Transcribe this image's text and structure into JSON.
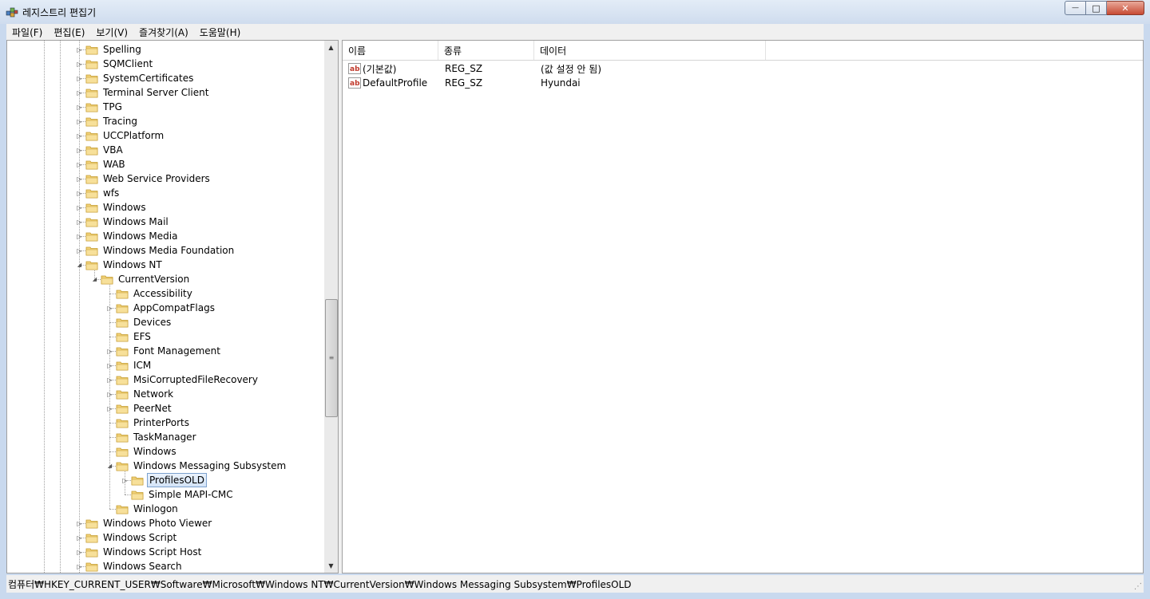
{
  "window": {
    "title": "레지스트리 편집기",
    "minimize_glyph": "—",
    "maximize_glyph": "□",
    "close_glyph": "✕"
  },
  "menu": [
    "파일(F)",
    "편집(E)",
    "보기(V)",
    "즐겨찾기(A)",
    "도움말(H)"
  ],
  "tree": [
    {
      "label": "Spelling",
      "depth": 0,
      "expander": "collapsed"
    },
    {
      "label": "SQMClient",
      "depth": 0,
      "expander": "collapsed"
    },
    {
      "label": "SystemCertificates",
      "depth": 0,
      "expander": "collapsed"
    },
    {
      "label": "Terminal Server Client",
      "depth": 0,
      "expander": "collapsed"
    },
    {
      "label": "TPG",
      "depth": 0,
      "expander": "collapsed"
    },
    {
      "label": "Tracing",
      "depth": 0,
      "expander": "collapsed"
    },
    {
      "label": "UCCPlatform",
      "depth": 0,
      "expander": "collapsed"
    },
    {
      "label": "VBA",
      "depth": 0,
      "expander": "collapsed"
    },
    {
      "label": "WAB",
      "depth": 0,
      "expander": "collapsed"
    },
    {
      "label": "Web Service Providers",
      "depth": 0,
      "expander": "collapsed"
    },
    {
      "label": "wfs",
      "depth": 0,
      "expander": "collapsed"
    },
    {
      "label": "Windows",
      "depth": 0,
      "expander": "collapsed"
    },
    {
      "label": "Windows Mail",
      "depth": 0,
      "expander": "collapsed"
    },
    {
      "label": "Windows Media",
      "depth": 0,
      "expander": "collapsed"
    },
    {
      "label": "Windows Media Foundation",
      "depth": 0,
      "expander": "collapsed"
    },
    {
      "label": "Windows NT",
      "depth": 0,
      "expander": "expanded"
    },
    {
      "label": "CurrentVersion",
      "depth": 1,
      "expander": "expanded"
    },
    {
      "label": "Accessibility",
      "depth": 2,
      "expander": "none"
    },
    {
      "label": "AppCompatFlags",
      "depth": 2,
      "expander": "collapsed"
    },
    {
      "label": "Devices",
      "depth": 2,
      "expander": "none"
    },
    {
      "label": "EFS",
      "depth": 2,
      "expander": "none"
    },
    {
      "label": "Font Management",
      "depth": 2,
      "expander": "collapsed"
    },
    {
      "label": "ICM",
      "depth": 2,
      "expander": "collapsed"
    },
    {
      "label": "MsiCorruptedFileRecovery",
      "depth": 2,
      "expander": "collapsed"
    },
    {
      "label": "Network",
      "depth": 2,
      "expander": "collapsed"
    },
    {
      "label": "PeerNet",
      "depth": 2,
      "expander": "collapsed"
    },
    {
      "label": "PrinterPorts",
      "depth": 2,
      "expander": "none"
    },
    {
      "label": "TaskManager",
      "depth": 2,
      "expander": "none"
    },
    {
      "label": "Windows",
      "depth": 2,
      "expander": "none"
    },
    {
      "label": "Windows Messaging Subsystem",
      "depth": 2,
      "expander": "expanded"
    },
    {
      "label": "ProfilesOLD",
      "depth": 3,
      "expander": "collapsed",
      "selected": true
    },
    {
      "label": "Simple MAPI-CMC",
      "depth": 3,
      "expander": "none"
    },
    {
      "label": "Winlogon",
      "depth": 2,
      "expander": "none"
    },
    {
      "label": "Windows Photo Viewer",
      "depth": 0,
      "expander": "collapsed"
    },
    {
      "label": "Windows Script",
      "depth": 0,
      "expander": "collapsed"
    },
    {
      "label": "Windows Script Host",
      "depth": 0,
      "expander": "collapsed"
    },
    {
      "label": "Windows Search",
      "depth": 0,
      "expander": "collapsed"
    }
  ],
  "scrollbar": {
    "up_glyph": "▲",
    "down_glyph": "▼",
    "grip_glyph": "≡",
    "position": 0.63
  },
  "list": {
    "columns": [
      "이름",
      "종류",
      "데이터"
    ],
    "rows": [
      {
        "name": "(기본값)",
        "type": "REG_SZ",
        "data": "(값 설정 안 됨)"
      },
      {
        "name": "DefaultProfile",
        "type": "REG_SZ",
        "data": "Hyundai"
      }
    ]
  },
  "status": {
    "path": "컴퓨터₩HKEY_CURRENT_USER₩Software₩Microsoft₩Windows NT₩CurrentVersion₩Windows Messaging Subsystem₩ProfilesOLD",
    "grip_glyph": "⋰"
  },
  "colors": {
    "selection": "#d4e4f7",
    "folder": "#f2d27a",
    "ab_icon": "#c0392b"
  }
}
